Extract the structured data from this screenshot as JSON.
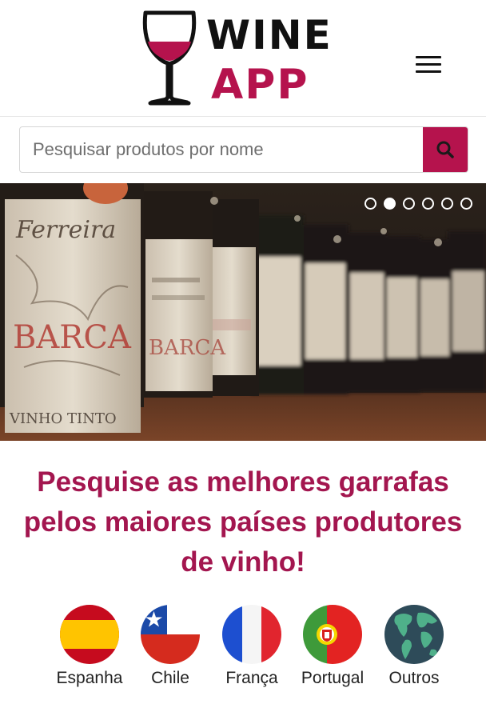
{
  "header": {
    "logo_line1": "WINE",
    "logo_line2": "APP",
    "menu_icon": "hamburger-menu-icon"
  },
  "search": {
    "placeholder": "Pesquisar produtos por nome",
    "value": "",
    "button_icon": "search-icon"
  },
  "carousel": {
    "slide_count": 6,
    "active_index": 1,
    "image": "vintage-wine-bottles-photo"
  },
  "headline": {
    "line1": "Pesquise as melhores garrafas",
    "line2": "pelos maiores países produtores",
    "line3": "de vinho!"
  },
  "countries": [
    {
      "label": "Espanha",
      "icon": "spain-flag-icon"
    },
    {
      "label": "Chile",
      "icon": "chile-flag-icon"
    },
    {
      "label": "França",
      "icon": "france-flag-icon"
    },
    {
      "label": "Portugal",
      "icon": "portugal-flag-icon"
    },
    {
      "label": "Outros",
      "icon": "globe-icon"
    }
  ],
  "colors": {
    "brand": "#b5134d",
    "headline": "#a3164f",
    "text": "#222222"
  }
}
